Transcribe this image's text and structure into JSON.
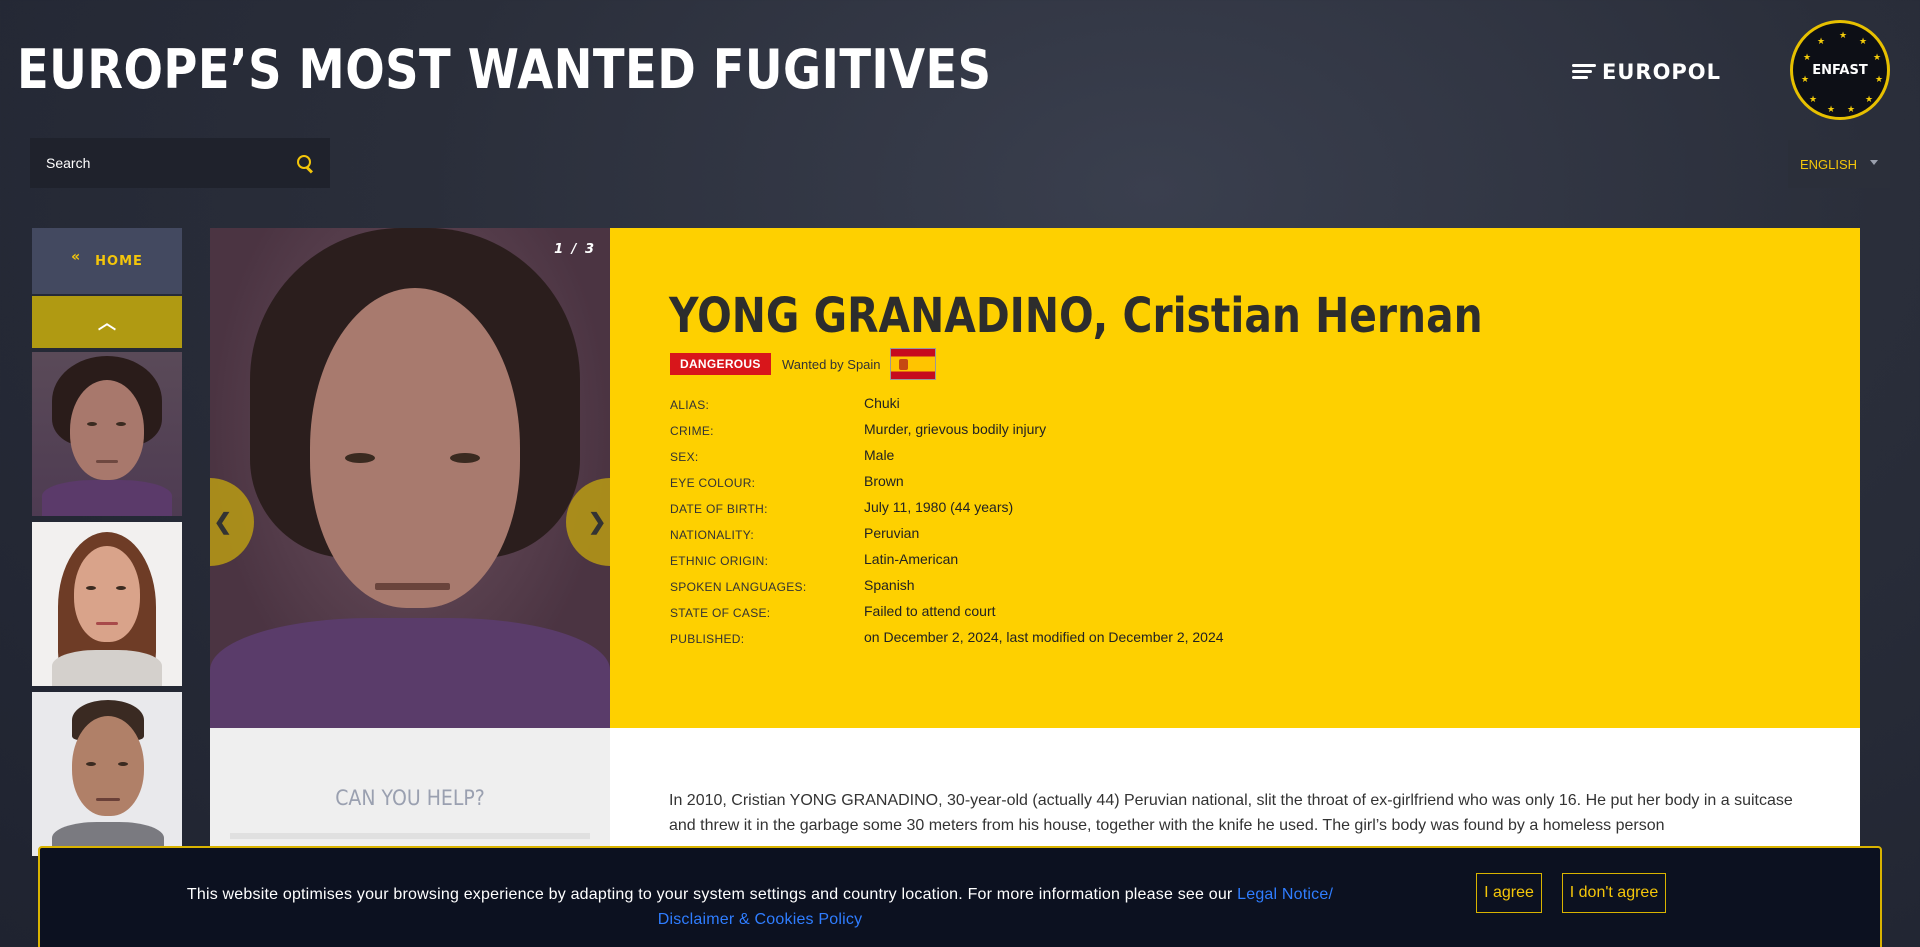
{
  "header": {
    "title": "EUROPE’S MOST WANTED FUGITIVES",
    "europol_logo_text": "EUROPOL",
    "enfast_badge_text": "ENFAST"
  },
  "search": {
    "placeholder": "Search"
  },
  "language": {
    "selected": "ENGLISH"
  },
  "sidebar": {
    "home_label": "HOME",
    "home_chevron": "«",
    "up_arrow": "︿"
  },
  "slider": {
    "counter": "1 / 3",
    "prev_arrow": "❮",
    "next_arrow": "❯"
  },
  "person": {
    "name": "YONG GRANADINO, Cristian Hernan",
    "badge": "DANGEROUS",
    "wanted_by": "Wanted by Spain",
    "details": [
      {
        "label": "ALIAS:",
        "value": "Chuki"
      },
      {
        "label": "CRIME:",
        "value": "Murder, grievous bodily injury"
      },
      {
        "label": "SEX:",
        "value": "Male"
      },
      {
        "label": "EYE COLOUR:",
        "value": "Brown"
      },
      {
        "label": "DATE OF BIRTH:",
        "value": "July 11, 1980 (44 years)"
      },
      {
        "label": "NATIONALITY:",
        "value": "Peruvian"
      },
      {
        "label": "ETHNIC ORIGIN:",
        "value": "Latin-American"
      },
      {
        "label": "SPOKEN LANGUAGES:",
        "value": "Spanish"
      },
      {
        "label": "STATE OF CASE:",
        "value": "Failed to attend court"
      },
      {
        "label": "PUBLISHED:",
        "value": "on December 2, 2024, last modified on December 2, 2024"
      }
    ],
    "description": "In 2010, Cristian YONG GRANADINO, 30-year-old (actually 44) Peruvian national, slit the throat of ex-girlfriend who was only 16. He put her body in a suitcase and threw it in the garbage some 30 meters from his house, together with the knife he used. The girl’s body was found by a homeless person"
  },
  "help": {
    "title": "CAN YOU HELP?"
  },
  "cookie": {
    "text": "This website optimises your browsing experience by adapting to your system settings and country location. For more information please see our ",
    "link_1": "Legal Notice/",
    "link_2": "Disclaimer & Cookies Policy",
    "agree": "I agree",
    "disagree": "I don't agree"
  },
  "colors": {
    "accent_yellow": "#fed000",
    "danger_red": "#d8161b",
    "link_blue": "#2f7dff"
  }
}
